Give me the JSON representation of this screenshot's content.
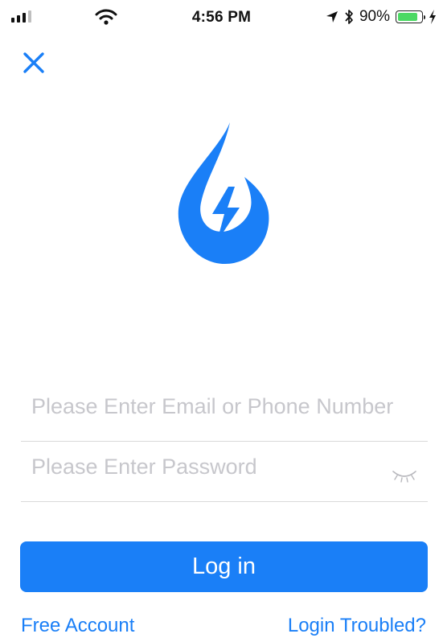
{
  "status_bar": {
    "time": "4:56 PM",
    "battery_percent": "90%",
    "battery_level": 0.9,
    "icons": [
      "signal-icon",
      "wifi-icon",
      "location-arrow-icon",
      "bluetooth-icon",
      "battery-icon",
      "charging-bolt-icon"
    ]
  },
  "header": {
    "close_icon": "close-icon"
  },
  "logo": {
    "icon": "water-drop-bolt-logo",
    "color": "#1a7ff7"
  },
  "form": {
    "email_placeholder": "Please Enter Email or Phone Number",
    "email_value": "",
    "password_placeholder": "Please Enter Password",
    "password_value": "",
    "password_visibility_icon": "eye-closed-icon",
    "login_label": "Log in"
  },
  "links": {
    "free_account": "Free Account",
    "login_troubled": "Login Troubled?"
  },
  "colors": {
    "accent": "#1a7ff7",
    "placeholder": "#c7c7cc",
    "battery": "#4cd964"
  }
}
